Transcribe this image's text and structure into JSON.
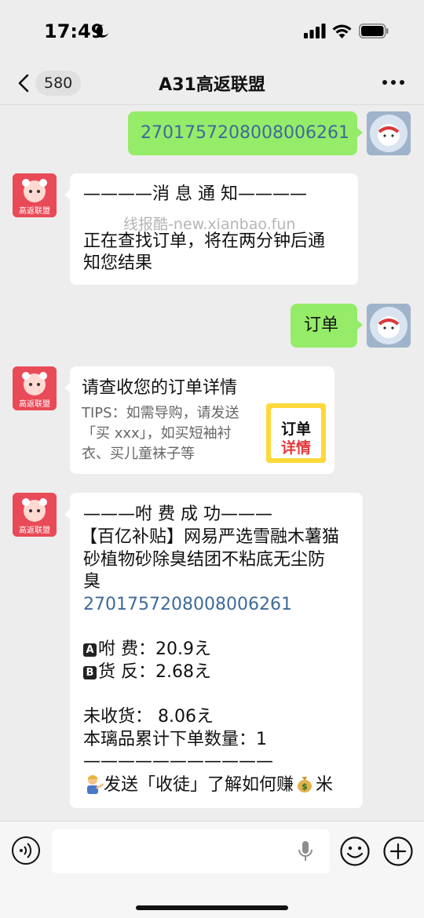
{
  "status_bar": {
    "time": "17:49"
  },
  "nav": {
    "unread_count": "580",
    "title": "A31高返联盟"
  },
  "messages": {
    "m1": {
      "text": "2701757208008006261"
    },
    "m2": {
      "line1": "————消 息 通 知————",
      "line2": "正在查找订单，将在两分钟后通",
      "line3": "知您结果"
    },
    "watermark": "线报酷-new.xianbao.fun",
    "m3": {
      "text": "订单"
    },
    "m4": {
      "title": "请查收您的订单详情",
      "desc1": "TIPS：如需导购，请发送",
      "desc2": "「买 xxx」，如买短袖衬",
      "desc3": "衣、买儿童袜子等",
      "thumb_line1": "订单",
      "thumb_line2": "详情"
    },
    "m5": {
      "header": "———咐 费 成 功———",
      "product1": "【百亿补贴】网易严选雪融木薯猫",
      "product2": "砂植物砂除臭结团不粘底无尘防",
      "product3": "臭",
      "order_no": "2701757208008006261",
      "label_a": "A",
      "fee": "咐 费：20.9え",
      "label_b": "B",
      "rebate": "货 反：2.68え",
      "pending": "未收货： 8.06え",
      "count": "本璃品累计下单数量：1",
      "divider": "———————————",
      "footer": "发送「收徒」了解如何赚",
      "footer_end": "米"
    }
  },
  "bot_avatar_label": "高返联盟",
  "colors": {
    "green_bubble": "#95ec69",
    "link": "#3e6a9a",
    "bot_avatar": "#e94a58",
    "bg": "#ededed"
  }
}
